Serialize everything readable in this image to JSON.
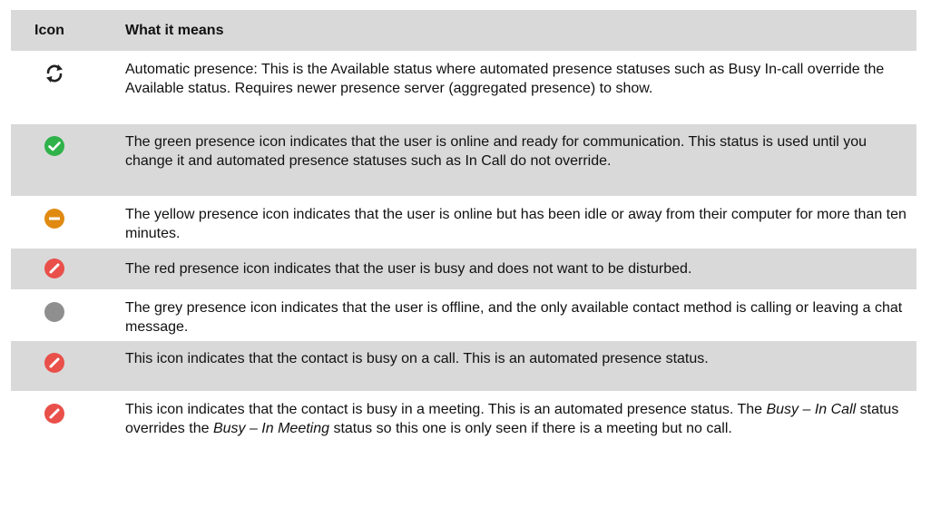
{
  "header": {
    "icon_col": "Icon",
    "meaning_col": "What it means"
  },
  "rows": [
    {
      "icon": "automatic-presence-icon",
      "text": "Automatic presence: This is the Available status where automated presence statuses such as Busy In-call override the Available status. Requires newer presence server (aggregated presence) to show."
    },
    {
      "icon": "green-available-icon",
      "color": "#2fb24a",
      "text": "The green presence icon indicates that the user is online and ready for communication. This status is used until you change it and automated presence statuses such as In Call do not override."
    },
    {
      "icon": "yellow-away-icon",
      "color": "#e08a12",
      "text": "The yellow presence icon indicates that the user is online but has been idle or away from their computer for more than ten minutes."
    },
    {
      "icon": "red-busy-icon",
      "color": "#e9504a",
      "text": "The red presence icon indicates that the user is busy and does not want to be disturbed."
    },
    {
      "icon": "grey-offline-icon",
      "color": "#8f8f8f",
      "text": "The grey presence icon indicates that the user is offline, and the only available contact method is calling or leaving a chat message."
    },
    {
      "icon": "busy-in-call-icon",
      "color": "#e9504a",
      "text": "This icon indicates that the contact is busy on a call. This is an automated presence status."
    },
    {
      "icon": "busy-in-meeting-icon",
      "color": "#e9504a",
      "text_a": "This icon indicates that the contact is busy in a meeting. This is an automated presence status. The ",
      "text_em1": "Busy – In Call",
      "text_b": " status overrides the ",
      "text_em2": "Busy – In Meeting",
      "text_c": " status so this one is only seen if there is a meeting but no call."
    }
  ]
}
